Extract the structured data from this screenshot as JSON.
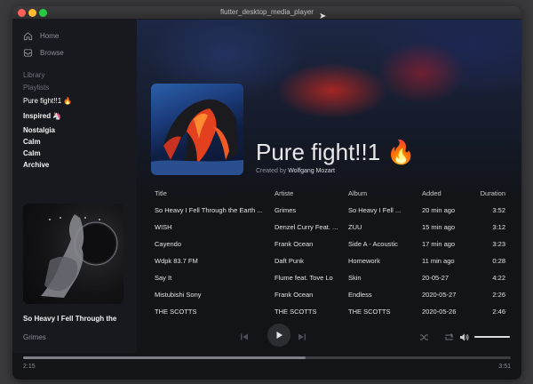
{
  "window": {
    "title": "flutter_desktop_media_player"
  },
  "sidebar": {
    "nav": [
      {
        "label": "Home",
        "icon": "home-icon"
      },
      {
        "label": "Browse",
        "icon": "browse-icon"
      }
    ],
    "library_label": "Library",
    "playlists_label": "Playlists",
    "playlists": [
      "Pure fight!!1 🔥",
      "Inspired 🦄",
      "Nostalgia",
      "Calm",
      "Calm",
      "Archive"
    ]
  },
  "header": {
    "playlist_name": "Pure fight!!1 🔥",
    "created_by_label": "Created by",
    "creator": "Wolfgang Mozart"
  },
  "table": {
    "columns": [
      "Title",
      "Artiste",
      "Album",
      "Added",
      "Duration"
    ],
    "rows": [
      {
        "title": "So Heavy I Fell Through the Earth ...",
        "artist": "Grimes",
        "album": "So Heavy I Fell ...",
        "added": "20 min ago",
        "duration": "3:52"
      },
      {
        "title": "WISH",
        "artist": "Denzel Curry Feat. ...",
        "album": "ZUU",
        "added": "15 min ago",
        "duration": "3:12"
      },
      {
        "title": "Cayendo",
        "artist": "Frank Ocean",
        "album": "Side A - Acoustic",
        "added": "17 min ago",
        "duration": "3:23"
      },
      {
        "title": "Wdpk 83.7 FM",
        "artist": "Daft Punk",
        "album": "Homework",
        "added": "11 min ago",
        "duration": "0:28"
      },
      {
        "title": "Say It",
        "artist": "Flume feat. Tove Lo",
        "album": "Skin",
        "added": "20-05-27",
        "duration": "4:22"
      },
      {
        "title": "Mistubishi Sony",
        "artist": "Frank Ocean",
        "album": "Endless",
        "added": "2020-05-27",
        "duration": "2:26"
      },
      {
        "title": "THE SCOTTS",
        "artist": "THE SCOTTS",
        "album": "THE SCOTTS",
        "added": "2020-05-26",
        "duration": "2:46"
      }
    ]
  },
  "now_playing": {
    "title": "So Heavy I Fell Through the",
    "artist": "Grimes"
  },
  "player": {
    "current_time": "2:15",
    "total_time": "3:51",
    "progress_fraction": 0.58,
    "volume_fraction": 1.0
  },
  "colors": {
    "accent_fire": "#e0452a",
    "background": "#121418",
    "sidebar": "#17191f"
  }
}
